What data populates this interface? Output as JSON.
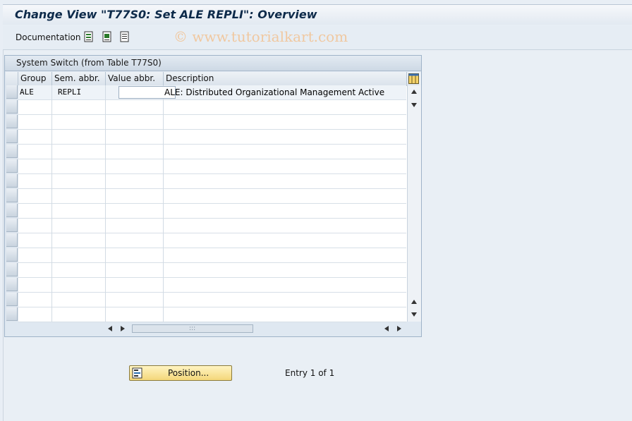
{
  "window": {
    "title": "Change View \"T77S0: Set ALE REPLI\": Overview"
  },
  "toolbar": {
    "documentation_label": "Documentation",
    "icons": [
      "select-all-icon",
      "select-block-icon",
      "deselect-all-icon"
    ]
  },
  "watermark": "© www.tutorialkart.com",
  "panel": {
    "title": "System Switch (from Table T77S0)"
  },
  "table": {
    "columns": [
      "Group",
      "Sem. abbr.",
      "Value abbr.",
      "Description"
    ],
    "rows": [
      {
        "group": "ALE",
        "sem_abbr": "REPLI",
        "value_abbr": "",
        "description": "ALE: Distributed Organizational Management Active"
      }
    ]
  },
  "footer": {
    "position_button": "Position...",
    "entry_text": "Entry 1 of 1"
  },
  "colors": {
    "button_yellow": "#f4d77a",
    "header_blue": "#dbe3ec",
    "title_text": "#0d2a4a"
  }
}
